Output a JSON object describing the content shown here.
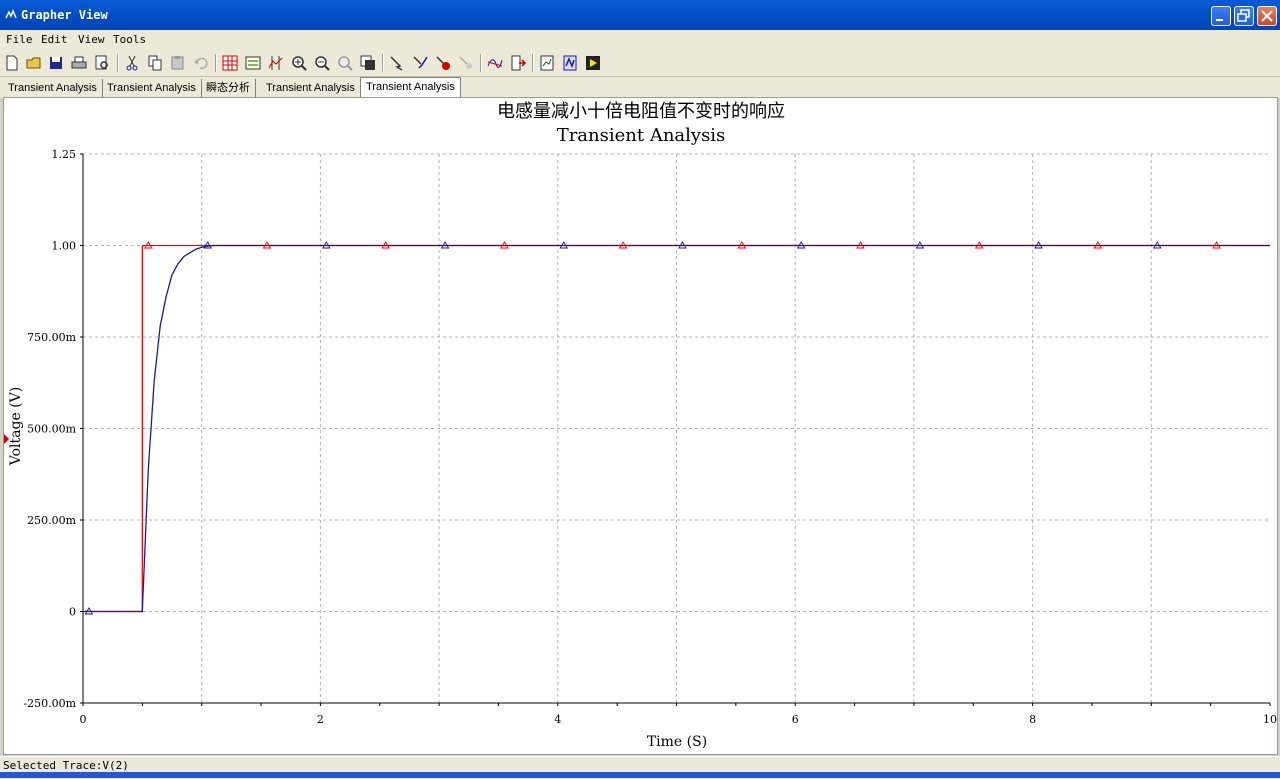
{
  "window": {
    "title": "Grapher View"
  },
  "menu": [
    "File",
    "Edit",
    "View",
    "Tools"
  ],
  "toolbar": {
    "icons": [
      "new-icon",
      "open-icon",
      "save-icon",
      "print-icon",
      "print-preview-icon",
      "cut-icon",
      "copy-icon",
      "paste-icon",
      "undo-icon",
      "grid-icon",
      "legend-icon",
      "cursors-icon",
      "zoom-in-icon",
      "zoom-out-icon",
      "zoom-full-icon",
      "overlay-icon",
      "select-marks-icon",
      "pick-trace-icon",
      "reverse-colors-icon",
      "clear-icon",
      "show-cursor-icon",
      "export-excel-icon",
      "properties-icon",
      "add-trace-icon",
      "export-labview-icon"
    ]
  },
  "tabs": [
    "Transient Analysis",
    "Transient Analysis",
    "瞬态分析",
    "Transient Analysis",
    "Transient Analysis"
  ],
  "active_tab": 4,
  "colors": {
    "trace_red": "#ff0000",
    "trace_blue": "#1a1aa6",
    "grid": "#b4b4b4",
    "titlebar": "#0350c8"
  },
  "status": "Selected Trace:V(2)",
  "chart_data": {
    "type": "line",
    "title": "电感量减小十倍电阻值不变时的响应",
    "subtitle": "Transient Analysis",
    "xlabel": "Time (S)",
    "ylabel": "Voltage (V)",
    "xlim": [
      0,
      10
    ],
    "ylim": [
      -0.25,
      1.25
    ],
    "xticks": [
      0,
      2,
      4,
      6,
      8,
      10
    ],
    "xtick_labels": [
      "0",
      "2",
      "4",
      "6",
      "8",
      "10"
    ],
    "yticks": [
      -0.25,
      0,
      0.25,
      0.5,
      0.75,
      1.0,
      1.25
    ],
    "ytick_labels": [
      "-250.00m",
      "0",
      "250.00m",
      "500.00m",
      "750.00m",
      "1.00",
      "1.25"
    ],
    "grid": true,
    "series": [
      {
        "color": "#ff0000",
        "x": [
          0,
          0.5,
          0.5,
          10
        ],
        "y": [
          0,
          0,
          1,
          1
        ]
      },
      {
        "color": "#1a1aa6",
        "x": [
          0,
          0.5,
          0.55,
          0.6,
          0.65,
          0.7,
          0.75,
          0.8,
          0.85,
          0.9,
          0.95,
          1.0,
          1.05,
          1.1,
          10
        ],
        "y": [
          0,
          0,
          0.39,
          0.63,
          0.78,
          0.86,
          0.92,
          0.95,
          0.97,
          0.98,
          0.99,
          0.995,
          0.998,
          1.0,
          1.0
        ]
      }
    ],
    "markers": [
      0.05,
      0.55,
      1.05,
      1.55,
      2.05,
      2.55,
      3.05,
      3.55,
      4.05,
      4.55,
      5.05,
      5.55,
      6.05,
      6.55,
      7.05,
      7.55,
      8.05,
      8.55,
      9.05,
      9.55
    ]
  }
}
